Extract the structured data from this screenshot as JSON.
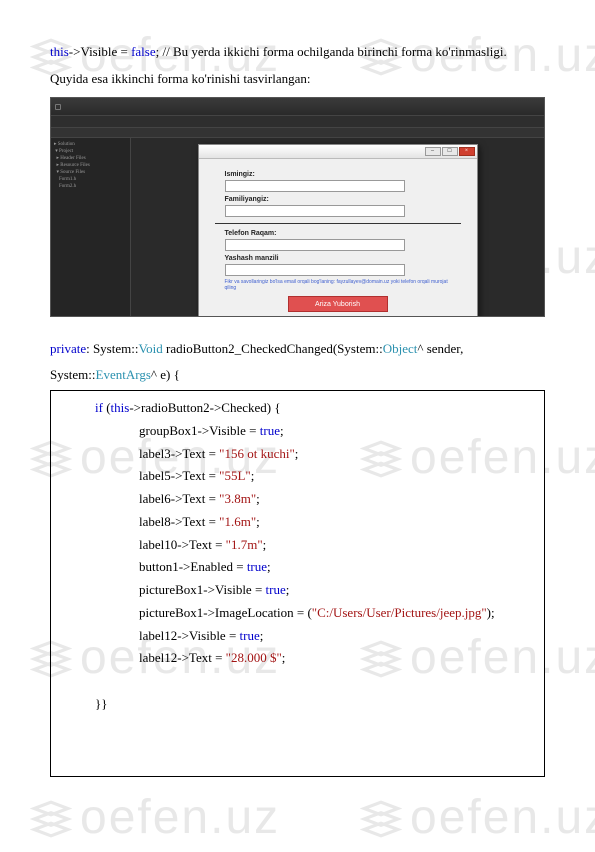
{
  "intro": {
    "line1_prefix": "this",
    "line1_mid": "->Visible = ",
    "line1_false": "false",
    "line1_rest": ";   //  Bu  yerda  ikkichi  forma  ochilganda  birinchi  forma ko'rinmasligi.",
    "line2": "Quyida esa ikkinchi forma ko'rinishi tasvirlangan:"
  },
  "form": {
    "title": "",
    "label1": "Ismingiz:",
    "label2": "Familiyangiz:",
    "label3": "Telefon Raqam:",
    "label4": "Yashash manzili",
    "note": "Fikr va savollaringiz bo'lsa email orqali bog'laning: fayzullayev@domain.uz yoki telefon orqali murojat qiling",
    "submit": "Ariza Yuborish"
  },
  "code": {
    "sig_private": "private",
    "sig_mid1": ": System::",
    "sig_void": "Void",
    "sig_mid2": " radioButton2_CheckedChanged(System::",
    "sig_obj": "Object",
    "sig_mid3": "^ sender,",
    "sig_line2a": "System::",
    "sig_ea": "EventArgs",
    "sig_line2b": "^ e) {",
    "l_if": "if",
    "l_this": "this",
    "l_ifrest": "->radioButton2->Checked) {",
    "l1a": "groupBox1->Visible = ",
    "true": "true",
    "semi": ";",
    "l2a": "label3->Text = ",
    "l2s": "\"156 ot kuchi\"",
    "l3a": "label5->Text = ",
    "l3s": "\"55L\"",
    "l4a": "label6->Text = ",
    "l4s": "\"3.8m\"",
    "l5a": "label8->Text = ",
    "l5s": "\"1.6m\"",
    "l6a": "label10->Text = ",
    "l6s": "\"1.7m\"",
    "l7a": "button1->Enabled = ",
    "l8a": "pictureBox1->Visible = ",
    "l9a": "pictureBox1->ImageLocation = (",
    "l9s": "\"C:/Users/User/Pictures/jeep.jpg\"",
    "l9c": ");",
    "l10a": "label12->Visible = ",
    "l11a": "label12->Text = ",
    "l11s": "\"28.000 $\"",
    "close": "}}"
  },
  "watermark": "oefen.uz"
}
